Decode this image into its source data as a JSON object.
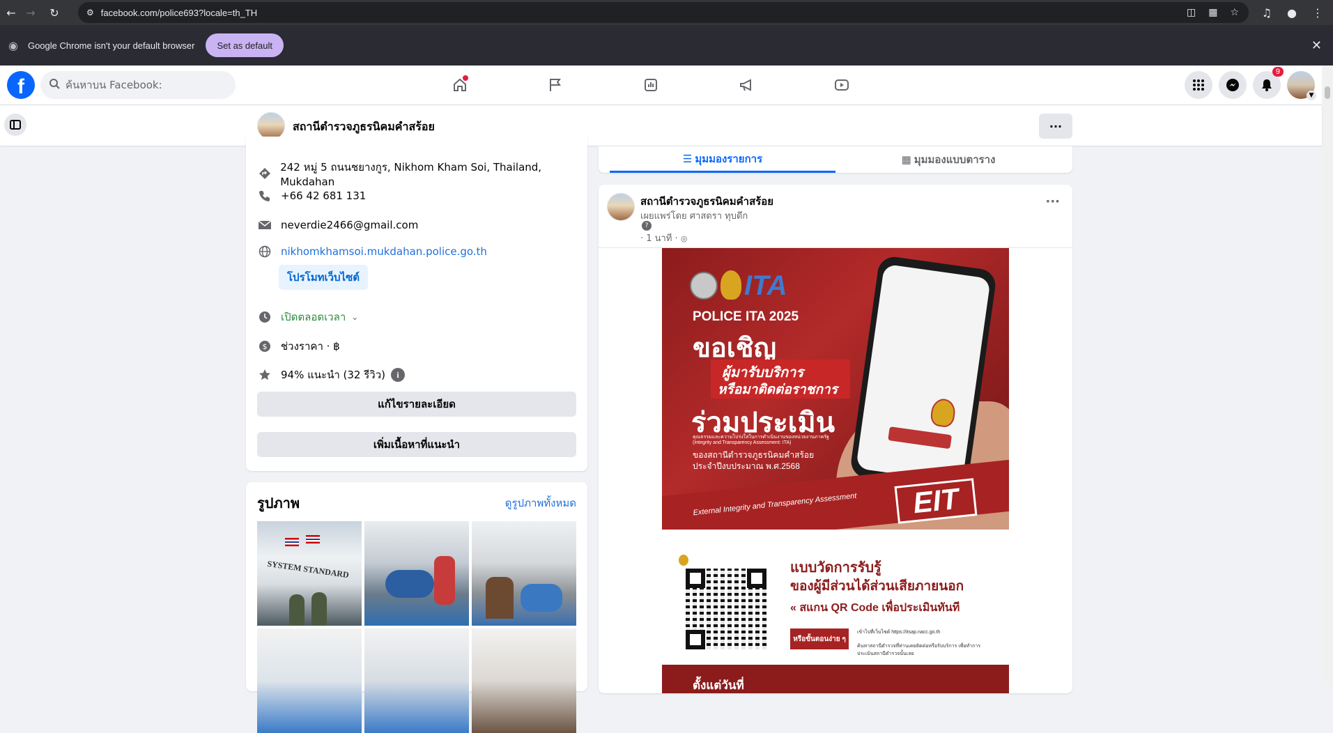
{
  "browser": {
    "url": "facebook.com/police693?locale=th_TH",
    "infobar_message": "Google Chrome isn't your default browser",
    "set_default_label": "Set as default"
  },
  "fb_header": {
    "search_placeholder": "ค้นหาบน Facebook:",
    "notification_count": "9",
    "nav_icons": [
      "home-icon",
      "flag-icon",
      "dashboard-icon",
      "megaphone-icon",
      "video-icon"
    ],
    "brand_color": "#0866ff"
  },
  "page": {
    "name": "สถานีตำรวจภูธรนิคมคำสร้อย",
    "more_label": "···"
  },
  "about": {
    "address": "242 หมู่ 5 ถนนชยางกูร, Nikhom Kham Soi, Thailand, Mukdahan",
    "phone": "+66 42 681 131",
    "email": "neverdie2466@gmail.com",
    "website": "nikhomkhamsoi.mukdahan.police.go.th",
    "promote_website": "โปรโมทเว็บไซต์",
    "hours": "เปิดตลอดเวลา",
    "price_range": "ช่วงราคา · ฿",
    "rating": "94% แนะนำ (32 รีวิว)",
    "edit_details": "แก้ไขรายละเอียด",
    "add_featured": "เพิ่มเนื้อหาที่แนะนำ"
  },
  "photos": {
    "title": "รูปภาพ",
    "see_all": "ดูรูปภาพทั้งหมด",
    "sign_text": "SYSTEM STANDARD"
  },
  "tabs": {
    "list_view": "มุมมองรายการ",
    "grid_view": "มุมมองแบบตาราง"
  },
  "post": {
    "author": "สถานีตำรวจภูธรนิคมคำสร้อย",
    "shared_by": "เผยแพร่โดย ศาสตรา ทุบดึก",
    "time": "· 1 นาที ·",
    "poster": {
      "logo_text": "ITA",
      "title_en": "POLICE ITA 2025",
      "invite": "ขอเชิญ",
      "line1": "ผู้มารับบริการ",
      "line2": "หรือมาติดต่อราชการ",
      "evaluate": "ร่วมประเมิน",
      "sub1": "คุณธรรมและความโปร่งใสในการดำเนินงานของหน่วยงานภาครัฐ",
      "sub2": "(Integrity and Transparency Assessment: ITA)",
      "station": "ของสถานีตำรวจภูธรนิคมคำสร้อย",
      "year": "ประจำปีงบประมาณ พ.ศ.2568",
      "eit_en": "External Integrity and Transparency Assessment",
      "eit": "EIT",
      "survey1": "แบบวัดการรับรู้",
      "survey2": "ของผู้มีส่วนได้ส่วนเสียภายนอก",
      "scan": "สแกน QR Code เพื่อประเมินทันที",
      "or_steps": "หรือขั้นตอนง่าย ๆ",
      "step1": "เข้าไปที่เว็บไซต์ https://itsap.nacc.go.th",
      "step2": "ค้นหาสถานีตำรวจที่ท่านเคยติดต่อหรือรับบริการ เพื่อทำการประเมินสถานีตำรวจนั้นเลย",
      "from_today": "ตั้งแต่วันที่"
    }
  }
}
